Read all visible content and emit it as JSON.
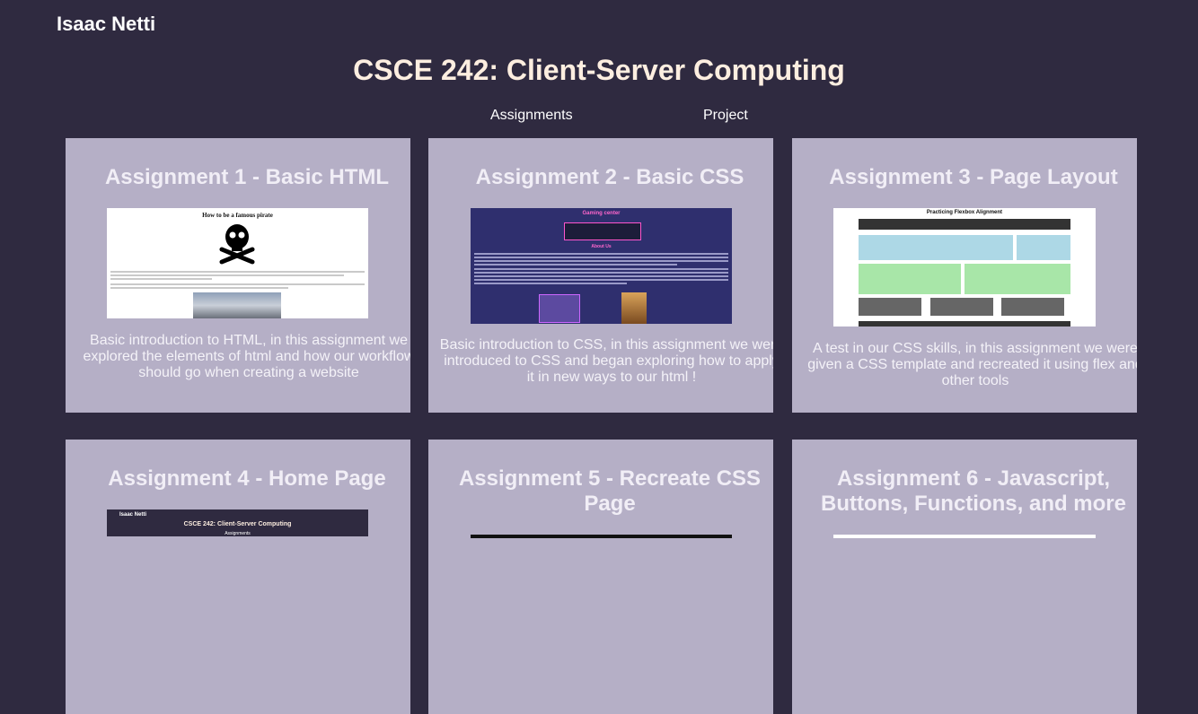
{
  "header": {
    "author": "Isaac Netti",
    "course_title": "CSCE 242: Client-Server Computing"
  },
  "nav": {
    "items": [
      {
        "label": "Assignments"
      },
      {
        "label": "Project"
      }
    ]
  },
  "cards": [
    {
      "title": "Assignment 1 - Basic HTML",
      "description": "Basic introduction to HTML, in this assignment we explored the elements of html and how our workflow should go when creating a website",
      "thumb": {
        "heading": "How to be a famous pirate"
      }
    },
    {
      "title": "Assignment 2 - Basic CSS",
      "description": "Basic introduction to CSS, in this assignment we were introduced to CSS and began exploring how to apply it in new ways to our html !",
      "thumb": {
        "heading": "Gaming center",
        "subheading": "About Us"
      }
    },
    {
      "title": "Assignment 3 - Page Layout",
      "description": "A test in our CSS skills, in this assignment we were given a CSS template and recreated it using flex and other tools",
      "thumb": {
        "heading": "Practicing Flexbox Alignment"
      }
    },
    {
      "title": "Assignment 4 - Home Page",
      "description": "",
      "thumb": {
        "author": "Isaac Netti",
        "heading": "CSCE 242: Client-Server Computing",
        "subheading": "Assignments"
      }
    },
    {
      "title": "Assignment 5 - Recreate CSS Page",
      "description": "",
      "thumb": {}
    },
    {
      "title": "Assignment 6 - Javascript, Buttons, Functions, and more",
      "description": "",
      "thumb": {}
    }
  ],
  "colors": {
    "background": "#2f2a40",
    "card": "#b5afc6",
    "title": "#fdeee0"
  }
}
